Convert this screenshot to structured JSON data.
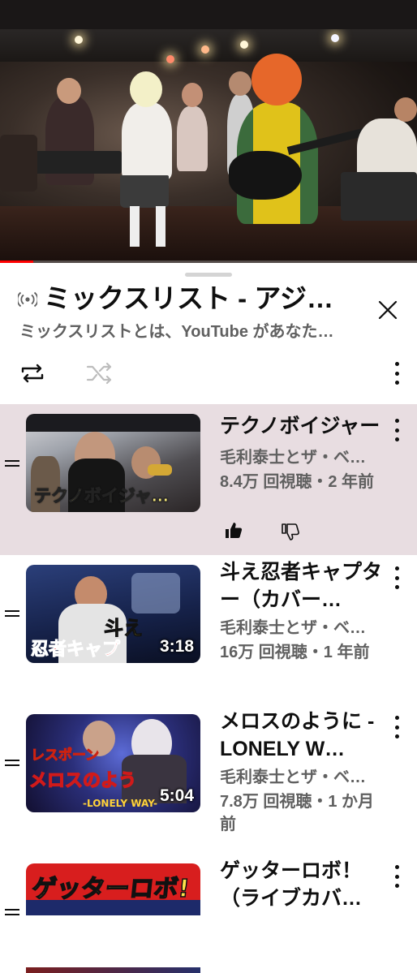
{
  "player": {
    "progress_fraction": 0.08
  },
  "playlist": {
    "title": "ミックスリスト - アジアの純真",
    "subtitle": "ミックスリストとは、YouTube があなたのために作成したプレイリストです",
    "icons": {
      "radio": "radio-broadcast-icon",
      "close": "close-icon",
      "loop": "loop-icon",
      "shuffle": "shuffle-icon",
      "more": "more-vert-icon"
    }
  },
  "videos": [
    {
      "title": "テクノボイジャー",
      "channel": "毛利泰士とザ・ベ…",
      "meta": "8.4万 回視聴・2 年前",
      "duration": "",
      "thumb_caption": "テクノボイジャ…",
      "active": true,
      "like_icon": "thumbs-up-icon",
      "dislike_icon": "thumbs-down-icon"
    },
    {
      "title": "斗え忍者キャプター（カバー…",
      "channel": "毛利泰士とザ・ベ…",
      "meta": "16万 回視聴・1 年前",
      "duration": "3:18",
      "thumb_caption": "斗え",
      "thumb_caption2": "忍者キャプ",
      "active": false
    },
    {
      "title": "メロスのように -LONELY W…",
      "channel": "毛利泰士とザ・ベ…",
      "meta": "7.8万 回視聴・1 か月前",
      "duration": "5:04",
      "thumb_caption": "メロスのよう",
      "thumb_caption2": "レスポーン",
      "thumb_caption3": "-LONELY WAY-",
      "active": false
    },
    {
      "title": "ゲッターロボ！（ライブカバ…",
      "channel": "",
      "meta": "",
      "duration": "",
      "thumb_caption": "ゲッターロボ!",
      "active": false
    }
  ],
  "colors": {
    "active_row": "#e8dde1",
    "progress": "#ff0000",
    "meta_text": "#606060"
  }
}
